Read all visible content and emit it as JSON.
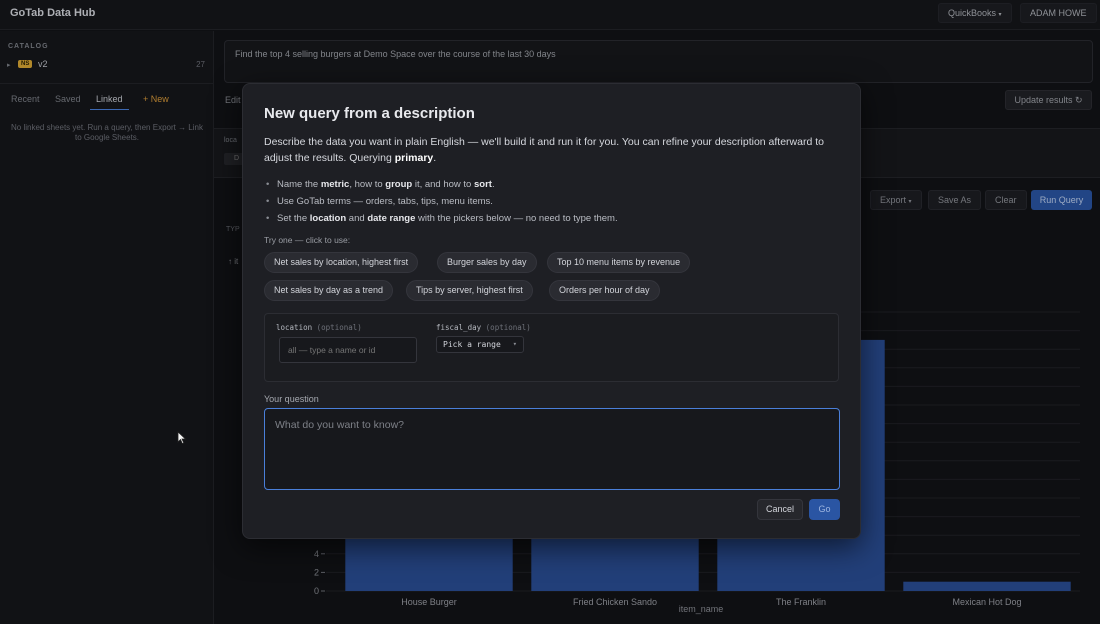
{
  "app": {
    "title": "GoTab Data Hub"
  },
  "header": {
    "quickbooks_label": "QuickBooks",
    "user_label": "ADAM HOWE"
  },
  "sidebar": {
    "catalog_heading": "CATALOG",
    "catalog_item": {
      "badge": "NS",
      "name": "v2",
      "count": "27"
    },
    "tabs": [
      "Recent",
      "Saved",
      "Linked",
      "+ New"
    ],
    "active_tab": "Linked",
    "empty_text": "No linked sheets yet. Run a query, then Export → Link to Google Sheets."
  },
  "main": {
    "query_text": "Find the top 4 selling burgers at Demo Space over the course of the last 30 days",
    "edit_label": "Edit",
    "update_button": "Update results ↻",
    "filter_label": "loca",
    "filter_chip": "D",
    "toolbar": {
      "export": "Export",
      "save_as": "Save As",
      "clear": "Clear",
      "run": "Run Query"
    },
    "typ_label": "TYP",
    "sort_indicator": "↑ it"
  },
  "chart_data": {
    "type": "bar",
    "categories": [
      "House Burger",
      "Fried Chicken Sando",
      "The Franklin",
      "Mexican Hot Dog"
    ],
    "values": [
      27,
      27,
      27,
      1
    ],
    "xlabel": "item_name",
    "ylabel": "",
    "visible_yticks": [
      0,
      2,
      4
    ],
    "ylim": [
      0,
      30
    ],
    "bar_color": "#2a4d94"
  },
  "modal": {
    "title": "New query from a description",
    "description_parts": [
      "Describe the data you want in plain English — we'll build it and run it for you. You can refine your description afterward to adjust the results. Querying ",
      "primary",
      "."
    ],
    "tips": [
      [
        "Name the ",
        "metric",
        ", how to ",
        "group",
        " it, and how to ",
        "sort",
        "."
      ],
      [
        "Use GoTab terms — orders, tabs, tips, menu items."
      ],
      [
        "Set the ",
        "location",
        " and ",
        "date range",
        " with the pickers below — no need to type them."
      ]
    ],
    "try_one_label": "Try one — click to use:",
    "suggestions": [
      "Net sales by location, highest first",
      "Burger sales by day",
      "Top 10 menu items by revenue",
      "Net sales by day as a trend",
      "Tips by server, highest first",
      "Orders per hour of day"
    ],
    "params": {
      "location_label": "location",
      "location_optional": "(optional)",
      "location_placeholder": "all — type a name or id",
      "fiscal_label": "fiscal_day",
      "fiscal_optional": "(optional)",
      "range_button": "Pick a range"
    },
    "question_label": "Your question",
    "question_placeholder": "What do you want to know?",
    "cancel_label": "Cancel",
    "go_label": "Go"
  },
  "colors": {
    "accent": "#2a55a3",
    "focus": "#4a7fd9",
    "badge": "#d8a734",
    "new_tab": "#d99a3a"
  }
}
